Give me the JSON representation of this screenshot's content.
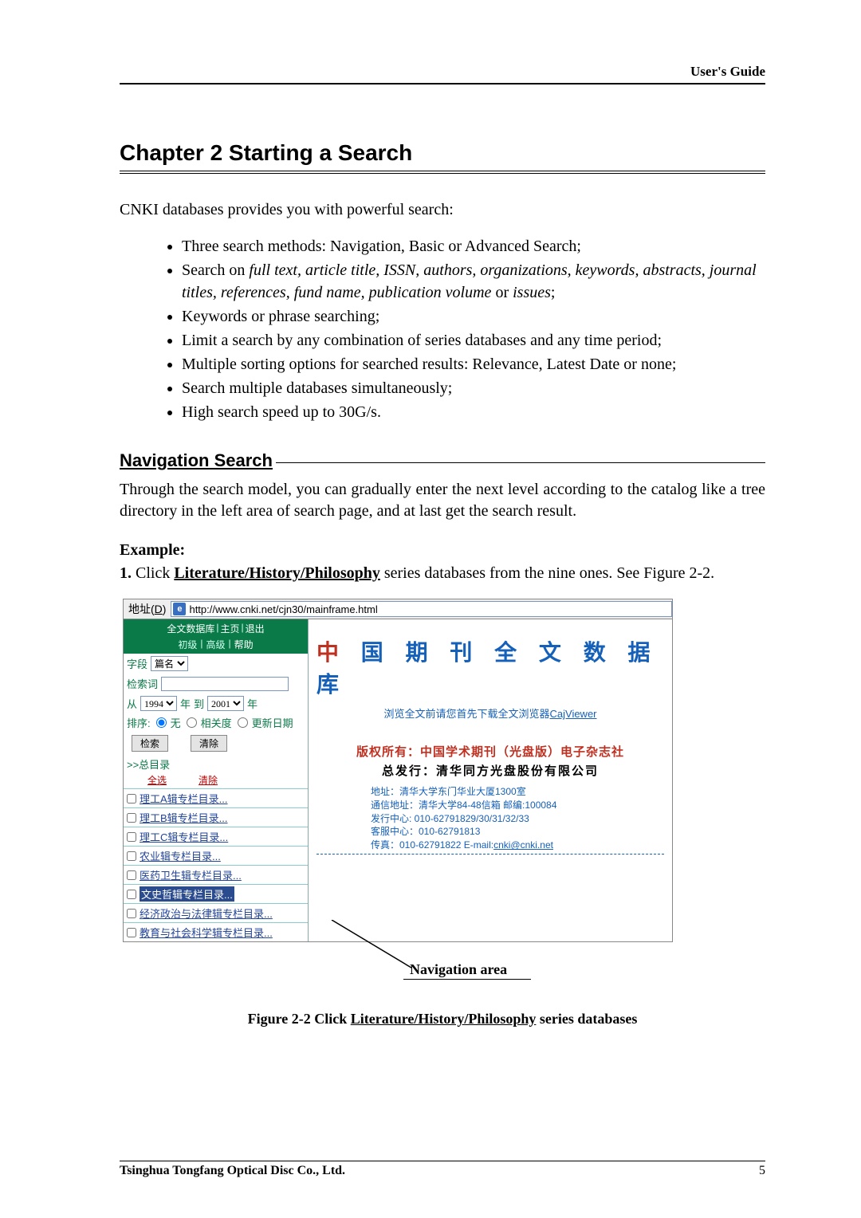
{
  "header": {
    "right": "User's Guide"
  },
  "chapter": {
    "title": "Chapter 2   Starting a Search"
  },
  "intro": "CNKI databases provides you with powerful search:",
  "features": {
    "i1a": "Three search methods: Navigation, Basic or Advanced Search;",
    "i2a": "Search on ",
    "i2b": "full text, article title, ISSN, authors, organizations, keywords, abstracts, journal titles, references, fund name, publication volume",
    "i2c": " or ",
    "i2d": "issues",
    "i2e": ";",
    "i3": "Keywords or phrase searching;",
    "i4": "Limit a search by any combination of series databases and any time period;",
    "i5": "Multiple sorting options for searched results: Relevance, Latest Date or none;",
    "i6": "Search multiple databases simultaneously;",
    "i7": "High search speed up to 30G/s."
  },
  "section": {
    "title": "Navigation Search"
  },
  "para1": "Through the search model, you can gradually enter the next level according to the catalog like a tree directory in the left area of search page, and at last get the search result.",
  "example": {
    "label": "Example:"
  },
  "step1": {
    "num": "1.",
    "pre": "  Click ",
    "link": "Literature/History/Philosophy",
    "post": " series databases from the nine ones. See Figure 2-2."
  },
  "addr": {
    "label_pre": "地址(",
    "label_u": "D",
    "label_post": ")",
    "ie_e": "e",
    "url": "http://www.cnki.net/cjn30/mainframe.html"
  },
  "nav": {
    "a": "全文数据库",
    "sep": "|",
    "b": "主页",
    "c": "退出",
    "d": "初级",
    "e": "高级",
    "f": "帮助"
  },
  "form": {
    "field_label": "字段",
    "field_value": "篇名",
    "term_label": "检索词",
    "from_label": "从",
    "year1": "1994",
    "year_unit": "年",
    "to_label": "到",
    "year2": "2001",
    "sort_label": "排序:",
    "r1": "无",
    "r2": "相关度",
    "r3": "更新日期",
    "btn_search": "检索",
    "btn_clear": "清除"
  },
  "catalog": {
    "head": ">>总目录",
    "sel_all": "全选",
    "clear": "清除",
    "items": [
      "理工A辑专栏目录...",
      "理工B辑专栏目录...",
      "理工C辑专栏目录...",
      "农业辑专栏目录...",
      "医药卫生辑专栏目录...",
      "文史哲辑专栏目录...",
      "经济政治与法律辑专栏目录...",
      "教育与社会科学辑专栏目录..."
    ]
  },
  "right": {
    "zhong": "中",
    "title_rest": " 国 期 刊 全 文 数 据 库",
    "subtitle_a": "浏览全文前请您首先下载全文浏览器",
    "subtitle_b": "CajViewer",
    "copyright": "版权所有：中国学术期刊（光盘版）电子杂志社",
    "publisher": "总发行：清华同方光盘股份有限公司",
    "info1": "地址：清华大学东门华业大厦1300室",
    "info2": "通信地址：清华大学84-48信箱  邮编:100084",
    "info3": "发行中心: 010-62791829/30/31/32/33",
    "info4": "客服中心：010-62791813",
    "info5a": "传真：010-62791822    E-mail:",
    "info5b": "cnki@cnki.net"
  },
  "nav_area_label": "Navigation area",
  "figcap": {
    "a": "Figure 2-2        Click ",
    "b": "Literature/History/Philosophy",
    "c": " series databases"
  },
  "footer": {
    "company": "Tsinghua Tongfang Optical Disc Co., Ltd.",
    "page": "5"
  }
}
